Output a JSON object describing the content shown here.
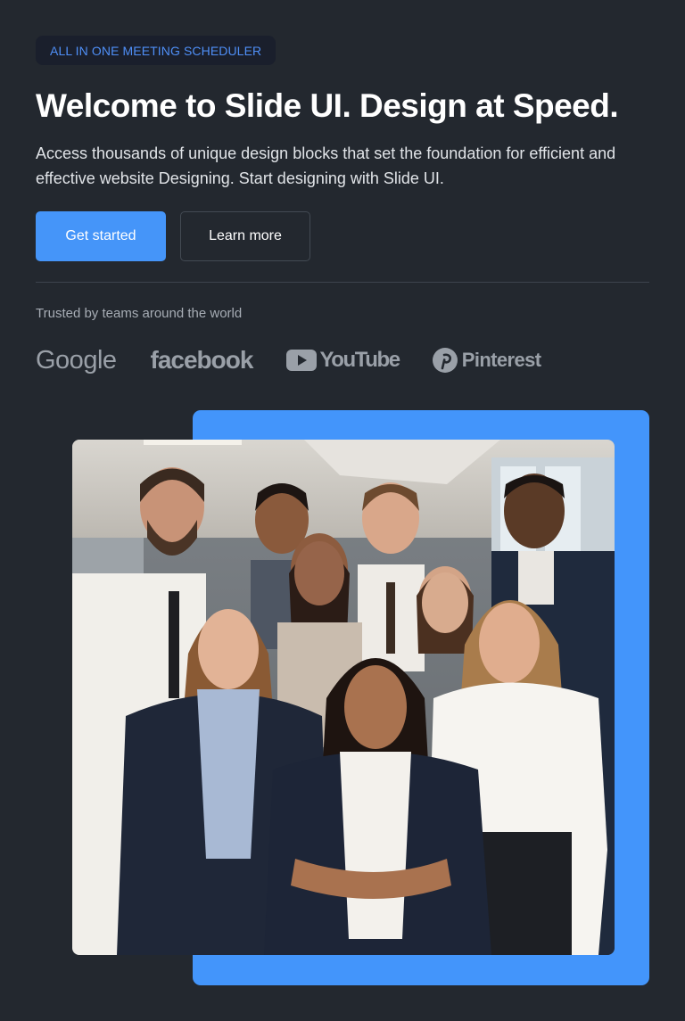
{
  "hero": {
    "badge": "ALL IN ONE MEETING SCHEDULER",
    "title": "Welcome to Slide UI. Design at Speed.",
    "subtitle": "Access thousands of unique design blocks that set the foundation for efficient and effective website Designing. Start designing with Slide UI."
  },
  "actions": {
    "primary_label": "Get started",
    "secondary_label": "Learn more"
  },
  "trusted": {
    "label": "Trusted by teams around the world",
    "logos": [
      {
        "name": "Google",
        "icon": "google-logo"
      },
      {
        "name": "facebook",
        "icon": "facebook-logo"
      },
      {
        "name": "YouTube",
        "icon": "youtube-logo"
      },
      {
        "name": "Pinterest",
        "icon": "pinterest-logo"
      }
    ]
  },
  "colors": {
    "background": "#23282f",
    "accent": "#4595f9",
    "badge_text": "#4f8ff7",
    "muted_text": "#a7adb5",
    "logo_gray": "#9aa0a8"
  }
}
